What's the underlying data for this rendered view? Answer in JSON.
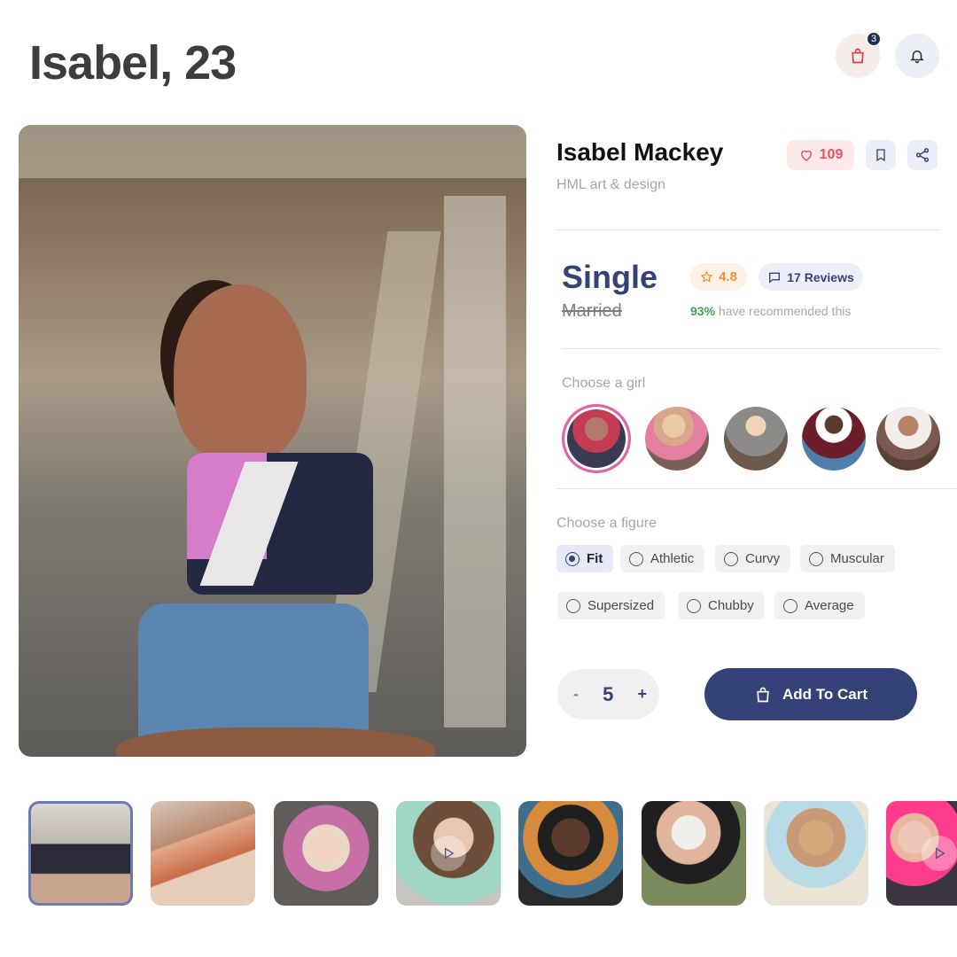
{
  "header": {
    "title": "Isabel, 23",
    "cart_badge": "3",
    "cart_icon": "shopping-bag-icon",
    "bell_icon": "bell-icon"
  },
  "profile": {
    "name": "Isabel Mackey",
    "subtitle": "HML art & design",
    "likes": "109",
    "status_current": "Single",
    "status_struck": "Married",
    "rating": "4.8",
    "reviews": "17 Reviews",
    "recommend_pct": "93%",
    "recommend_text": "have recommended this"
  },
  "girls": {
    "label": "Choose a girl",
    "selected_index": 0,
    "count": 5
  },
  "figure": {
    "label": "Choose a figure",
    "options": [
      "Fit",
      "Athletic",
      "Curvy",
      "Muscular",
      "Supersized",
      "Chubby",
      "Average"
    ],
    "selected": "Fit"
  },
  "cart": {
    "minus": "-",
    "quantity": "5",
    "plus": "+",
    "add_label": "Add To Cart"
  },
  "thumbnails": {
    "count": 8,
    "selected_index": 0,
    "video_indices": [
      3,
      7
    ]
  },
  "colors": {
    "accent": "#344278",
    "like": "#e2565f",
    "rating": "#e4953c",
    "recommend": "#3fa34f"
  }
}
